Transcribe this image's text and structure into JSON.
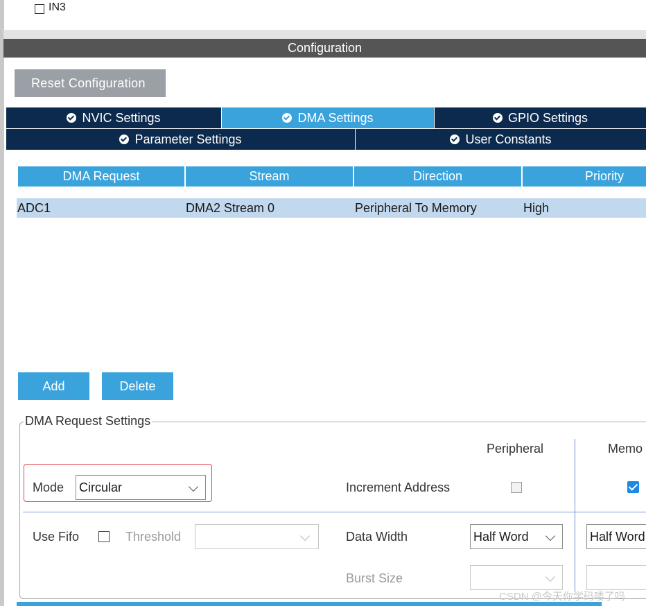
{
  "top": {
    "in3_label": "IN3",
    "in3_checked": false
  },
  "configuration": {
    "title": "Configuration",
    "reset_button": "Reset Configuration"
  },
  "tabs": [
    {
      "label": "NVIC Settings",
      "active": false
    },
    {
      "label": "DMA Settings",
      "active": true
    },
    {
      "label": "GPIO Settings",
      "active": false
    },
    {
      "label": "Parameter Settings",
      "active": false
    },
    {
      "label": "User Constants",
      "active": false
    }
  ],
  "dma_table": {
    "headers": [
      "DMA Request",
      "Stream",
      "Direction",
      "Priority"
    ],
    "rows": [
      [
        "ADC1",
        "DMA2 Stream 0",
        "Peripheral To Memory",
        "High"
      ]
    ]
  },
  "actions": {
    "add": "Add",
    "delete": "Delete"
  },
  "request_settings": {
    "title": "DMA Request Settings",
    "col_peripheral": "Peripheral",
    "col_memory": "Memo",
    "mode_label": "Mode",
    "mode_value": "Circular",
    "increment_address_label": "Increment Address",
    "increment_peripheral": false,
    "increment_memory": true,
    "use_fifo_label": "Use Fifo",
    "use_fifo": false,
    "threshold_label": "Threshold",
    "threshold_value": "",
    "data_width_label": "Data Width",
    "data_width_peripheral": "Half Word",
    "data_width_memory": "Half Word",
    "burst_size_label": "Burst Size",
    "burst_peripheral": "",
    "burst_memory": ""
  },
  "watermark": "CSDN @今天你学码喽了吗",
  "colors": {
    "accent": "#3aa3dc",
    "tab_dark": "#0c2a4d",
    "header_bar": "#555555",
    "row_bg": "#c1d8ee",
    "highlight_border": "#e0454f"
  }
}
